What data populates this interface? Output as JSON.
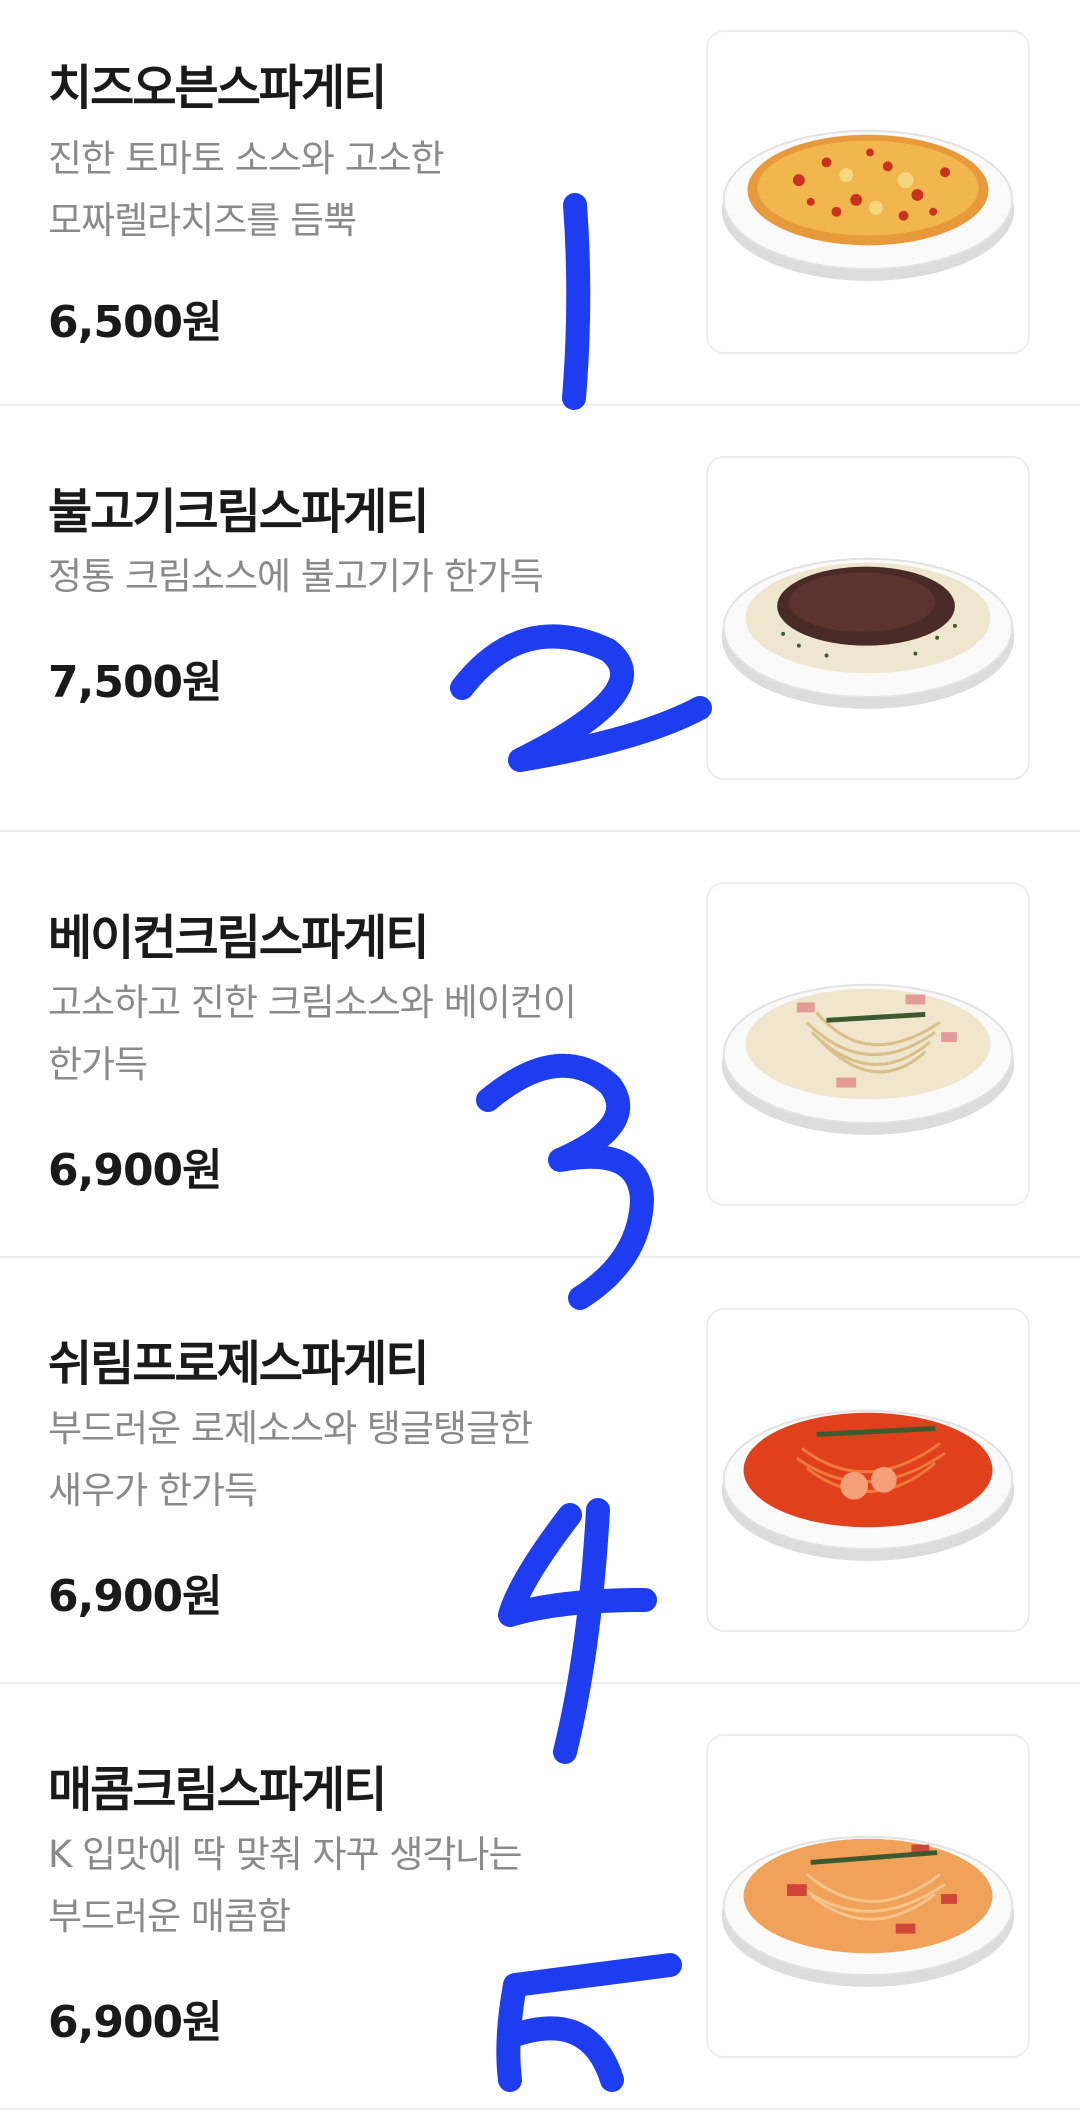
{
  "menu": {
    "items": [
      {
        "name": "치즈오븐스파게티",
        "description": [
          "진한 토마토 소스와 고소한",
          "모짜렐라치즈를 듬뿍"
        ],
        "price": "6,500원",
        "image_icon": "cheese-oven-spaghetti-photo"
      },
      {
        "name": "불고기크림스파게티",
        "description": [
          "정통 크림소스에 불고기가 한가득"
        ],
        "price": "7,500원",
        "image_icon": "bulgogi-cream-spaghetti-photo"
      },
      {
        "name": "베이컨크림스파게티",
        "description": [
          "고소하고 진한 크림소스와 베이컨이",
          "한가득"
        ],
        "price": "6,900원",
        "image_icon": "bacon-cream-spaghetti-photo"
      },
      {
        "name": "쉬림프로제스파게티",
        "description": [
          "부드러운 로제소스와 탱글탱글한",
          "새우가 한가득"
        ],
        "price": "6,900원",
        "image_icon": "shrimp-rose-spaghetti-photo"
      },
      {
        "name": "매콤크림스파게티",
        "description": [
          "K 입맛에 딱 맞춰 자꾸 생각나는",
          "부드러운 매콤함"
        ],
        "price": "6,900원",
        "image_icon": "spicy-cream-spaghetti-photo"
      }
    ]
  },
  "annotations": {
    "color": "#1f3df0",
    "numbers": [
      "1",
      "2",
      "3",
      "4",
      "5"
    ]
  }
}
